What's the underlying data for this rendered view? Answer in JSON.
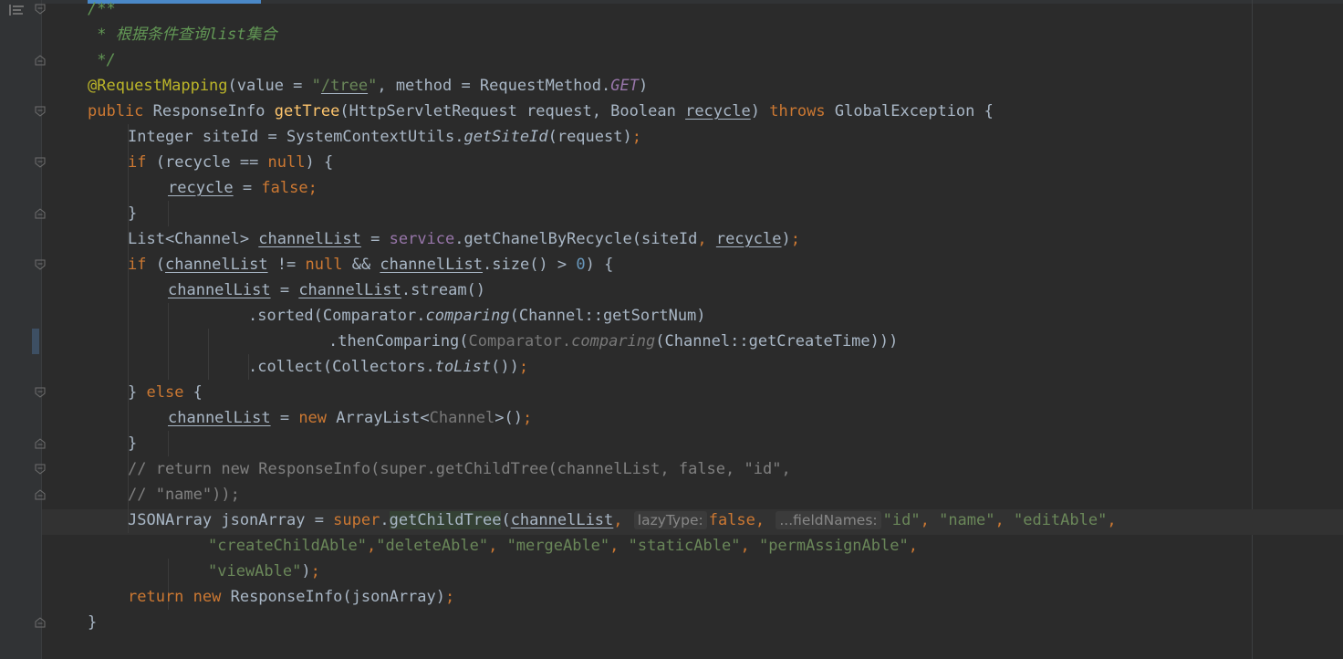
{
  "editor": {
    "lines": [
      {
        "indent": 0,
        "tokens": [
          {
            "t": "/**",
            "c": "doc"
          }
        ]
      },
      {
        "indent": 0,
        "tokens": [
          {
            "t": " * 根据条件查询list集合",
            "c": "doc"
          }
        ]
      },
      {
        "indent": 0,
        "tokens": [
          {
            "t": " */",
            "c": "doc"
          }
        ]
      },
      {
        "indent": 0,
        "tokens": [
          {
            "t": "@RequestMapping",
            "c": "anno"
          },
          {
            "t": "(value = "
          },
          {
            "t": "\"",
            "c": "str"
          },
          {
            "t": "/tree",
            "c": "str ul"
          },
          {
            "t": "\"",
            "c": "str"
          },
          {
            "t": ", method = RequestMethod."
          },
          {
            "t": "GET",
            "c": "constf"
          },
          {
            "t": ")"
          }
        ]
      },
      {
        "indent": 0,
        "tokens": [
          {
            "t": "public ",
            "c": "kw"
          },
          {
            "t": "ResponseInfo "
          },
          {
            "t": "getTree",
            "c": "fn"
          },
          {
            "t": "(HttpServletRequest request, Boolean "
          },
          {
            "t": "recycle",
            "c": "ul"
          },
          {
            "t": ") "
          },
          {
            "t": "throws ",
            "c": "kw"
          },
          {
            "t": "GlobalException {"
          }
        ]
      },
      {
        "indent": 1,
        "tokens": [
          {
            "t": "Integer siteId = SystemContextUtils."
          },
          {
            "t": "getSiteId",
            "c": "static"
          },
          {
            "t": "(request)"
          },
          {
            "t": ";",
            "c": "kw"
          }
        ]
      },
      {
        "indent": 1,
        "tokens": [
          {
            "t": "if ",
            "c": "kw"
          },
          {
            "t": "(recycle == "
          },
          {
            "t": "null",
            "c": "kw"
          },
          {
            "t": ") {"
          }
        ]
      },
      {
        "indent": 2,
        "tokens": [
          {
            "t": "recycle",
            "c": "ul"
          },
          {
            "t": " = "
          },
          {
            "t": "false",
            "c": "kw"
          },
          {
            "t": ";",
            "c": "kw"
          }
        ]
      },
      {
        "indent": 1,
        "tokens": [
          {
            "t": "}"
          }
        ]
      },
      {
        "indent": 1,
        "tokens": [
          {
            "t": "List<Channel> "
          },
          {
            "t": "channelList",
            "c": "ul"
          },
          {
            "t": " = "
          },
          {
            "t": "service",
            "c": "field"
          },
          {
            "t": ".getChanelByRecycle(siteId"
          },
          {
            "t": ", ",
            "c": "kw"
          },
          {
            "t": "recycle",
            "c": "ul"
          },
          {
            "t": ")"
          },
          {
            "t": ";",
            "c": "kw"
          }
        ]
      },
      {
        "indent": 1,
        "tokens": [
          {
            "t": "if ",
            "c": "kw"
          },
          {
            "t": "("
          },
          {
            "t": "channelList",
            "c": "ul"
          },
          {
            "t": " != "
          },
          {
            "t": "null ",
            "c": "kw"
          },
          {
            "t": "&& "
          },
          {
            "t": "channelList",
            "c": "ul"
          },
          {
            "t": ".size() > "
          },
          {
            "t": "0",
            "c": "num"
          },
          {
            "t": ") {"
          }
        ]
      },
      {
        "indent": 2,
        "tokens": [
          {
            "t": "channelList",
            "c": "ul"
          },
          {
            "t": " = "
          },
          {
            "t": "channelList",
            "c": "ul"
          },
          {
            "t": ".stream()"
          }
        ]
      },
      {
        "indent": 4,
        "tokens": [
          {
            "t": ".sorted(Comparator."
          },
          {
            "t": "comparing",
            "c": "static"
          },
          {
            "t": "(Channel::getSortNum)"
          }
        ]
      },
      {
        "indent": 6,
        "tokens": [
          {
            "t": ".thenComparing("
          },
          {
            "t": "Comparator.",
            "c": "gray"
          },
          {
            "t": "comparing",
            "c": "grayi"
          },
          {
            "t": "(Channel::getCreateTime)))"
          }
        ]
      },
      {
        "indent": 4,
        "tokens": [
          {
            "t": ".collect(Collectors."
          },
          {
            "t": "toList",
            "c": "static"
          },
          {
            "t": "())"
          },
          {
            "t": ";",
            "c": "kw"
          }
        ]
      },
      {
        "indent": 1,
        "tokens": [
          {
            "t": "} "
          },
          {
            "t": "else ",
            "c": "kw"
          },
          {
            "t": "{"
          }
        ]
      },
      {
        "indent": 2,
        "tokens": [
          {
            "t": "channelList",
            "c": "ul"
          },
          {
            "t": " = "
          },
          {
            "t": "new ",
            "c": "kw"
          },
          {
            "t": "ArrayList<"
          },
          {
            "t": "Channel",
            "c": "gray"
          },
          {
            "t": ">()"
          },
          {
            "t": ";",
            "c": "kw"
          }
        ]
      },
      {
        "indent": 1,
        "tokens": [
          {
            "t": "}"
          }
        ]
      },
      {
        "indent": 1,
        "tokens": [
          {
            "t": "// return new ResponseInfo(super.getChildTree(channelList, false, \"id\",",
            "c": "cmt"
          }
        ]
      },
      {
        "indent": 1,
        "tokens": [
          {
            "t": "// \"name\"));",
            "c": "cmt"
          }
        ]
      },
      {
        "indent": 1,
        "tokens": [
          {
            "t": "JSONArray jsonArray = "
          },
          {
            "t": "super",
            "c": "kw"
          },
          {
            "t": "."
          },
          {
            "t": "getChildTree",
            "c": "hl-method"
          },
          {
            "t": "("
          },
          {
            "t": "channelList",
            "c": "ul"
          },
          {
            "t": ", ",
            "c": "kw"
          },
          {
            "t": "lazyType:",
            "c": "hint"
          },
          {
            "t": "false",
            "c": "kw"
          },
          {
            "t": ", ",
            "c": "kw"
          },
          {
            "t": "...fieldNames:",
            "c": "hint"
          },
          {
            "t": "\"id\"",
            "c": "str"
          },
          {
            "t": ", ",
            "c": "kw"
          },
          {
            "t": "\"name\"",
            "c": "str"
          },
          {
            "t": ", ",
            "c": "kw"
          },
          {
            "t": "\"editAble\"",
            "c": "str"
          },
          {
            "t": ",",
            "c": "kw"
          }
        ]
      },
      {
        "indent": 3,
        "tokens": [
          {
            "t": "\"createChildAble\"",
            "c": "str"
          },
          {
            "t": ",",
            "c": "kw"
          },
          {
            "t": "\"deleteAble\"",
            "c": "str"
          },
          {
            "t": ", ",
            "c": "kw"
          },
          {
            "t": "\"mergeAble\"",
            "c": "str"
          },
          {
            "t": ", ",
            "c": "kw"
          },
          {
            "t": "\"staticAble\"",
            "c": "str"
          },
          {
            "t": ", ",
            "c": "kw"
          },
          {
            "t": "\"permAssignAble\"",
            "c": "str"
          },
          {
            "t": ",",
            "c": "kw"
          }
        ]
      },
      {
        "indent": 3,
        "tokens": [
          {
            "t": "\"viewAble\"",
            "c": "str"
          },
          {
            "t": ")"
          },
          {
            "t": ";",
            "c": "kw"
          }
        ]
      },
      {
        "indent": 1,
        "tokens": [
          {
            "t": "return new ",
            "c": "kw"
          },
          {
            "t": "ResponseInfo(jsonArray)"
          },
          {
            "t": ";",
            "c": "kw"
          }
        ]
      },
      {
        "indent": 0,
        "tokens": [
          {
            "t": "}"
          }
        ]
      }
    ],
    "fold_markers": [
      0,
      2,
      4,
      6,
      8,
      10,
      15,
      17,
      18,
      19,
      24
    ],
    "current_line": 20
  },
  "colors": {
    "background": "#2b2b2b",
    "gutter": "#313335",
    "keyword": "#cc7832",
    "string": "#6a8759",
    "doc_comment": "#629755",
    "comment": "#808080",
    "annotation": "#bbb529",
    "method_decl": "#ffc66d",
    "field": "#9876aa",
    "number": "#6897bb",
    "text": "#a9b7c6"
  },
  "icons": {
    "structure": "structure-icon",
    "fold": "fold-marker-icon"
  }
}
